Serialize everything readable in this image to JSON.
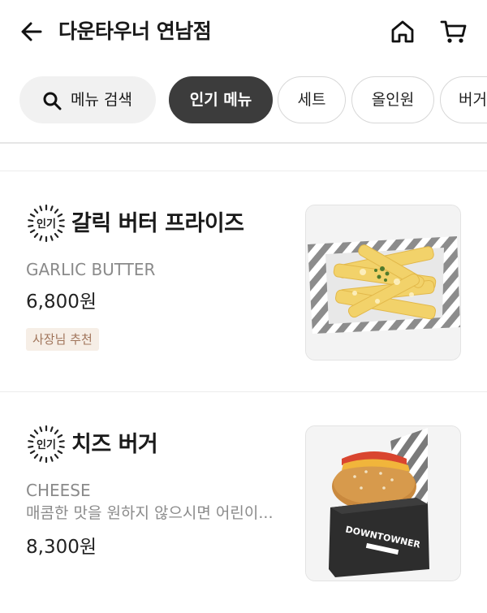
{
  "header": {
    "back_icon": "arrow-left-icon",
    "title": "다운타우너 연남점",
    "home_icon": "home-icon",
    "cart_icon": "cart-icon"
  },
  "chips": {
    "search_label": "메뉴 검색",
    "popular_label": "인기 메뉴",
    "set_label": "세트",
    "all_in_one_label": "올인원",
    "burger_label": "버거"
  },
  "items": [
    {
      "badge": "인기",
      "name": "갈릭 버터 프라이즈",
      "name_en": "GARLIC BUTTER",
      "price": "6,800원",
      "tag": "사장님 추천"
    },
    {
      "badge": "인기",
      "name": "치즈 버거",
      "name_en": "CHEESE",
      "desc": "매콤한 맛을 원하지 않으시면 어린이...",
      "price": "8,300원"
    }
  ],
  "colors": {
    "active_chip": "#3c3c3c",
    "tag_bg": "#f6eee6",
    "tag_text": "#a0745a",
    "subtext": "#8a8a8a"
  }
}
